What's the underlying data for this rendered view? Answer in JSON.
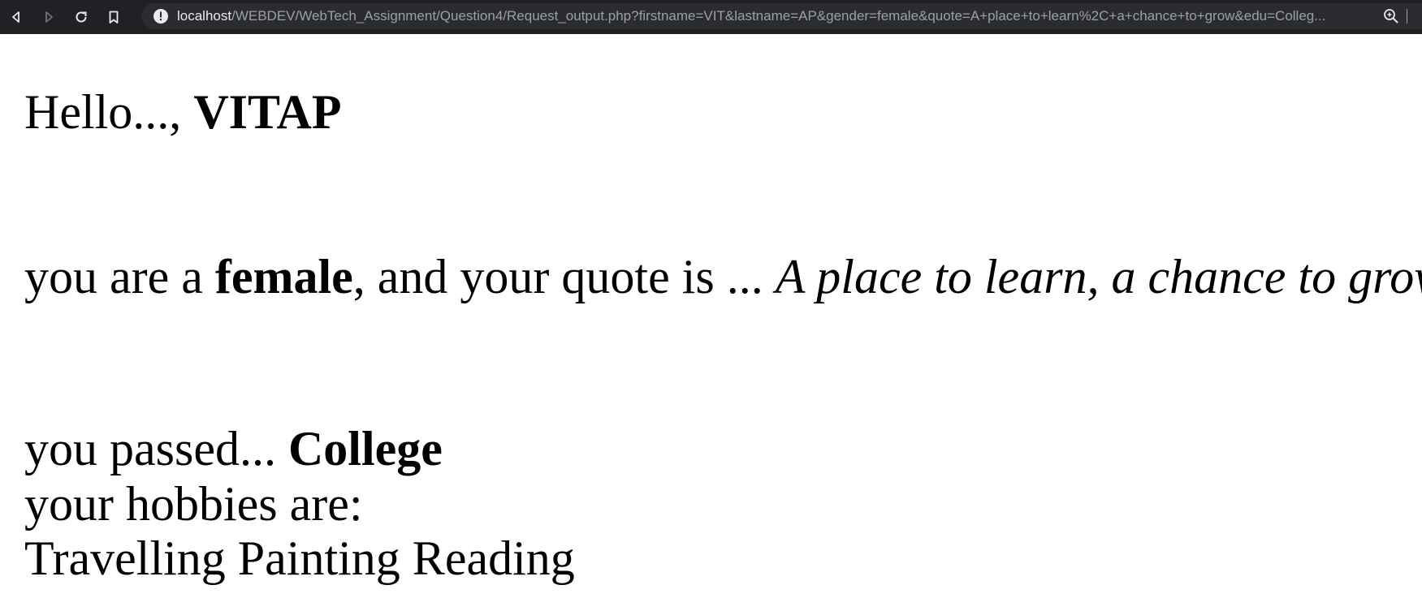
{
  "browser": {
    "url_host": "localhost",
    "url_path": "/WEBDEV/WebTech_Assignment/Question4/Request_output.php?firstname=VIT&lastname=AP&gender=female&quote=A+place+to+learn%2C+a+chance+to+grow&edu=Colleg..."
  },
  "greeting": {
    "prefix": "Hello..., ",
    "name": "VITAP"
  },
  "gender_sentence": {
    "prefix": "you are a ",
    "gender": "female",
    "middle": ", and your quote is ... ",
    "quote": "A place to learn, a chance to grow"
  },
  "education": {
    "prefix": "you passed... ",
    "value": "College"
  },
  "hobbies": {
    "label": "your hobbies are:",
    "list": "Travelling Painting Reading"
  }
}
